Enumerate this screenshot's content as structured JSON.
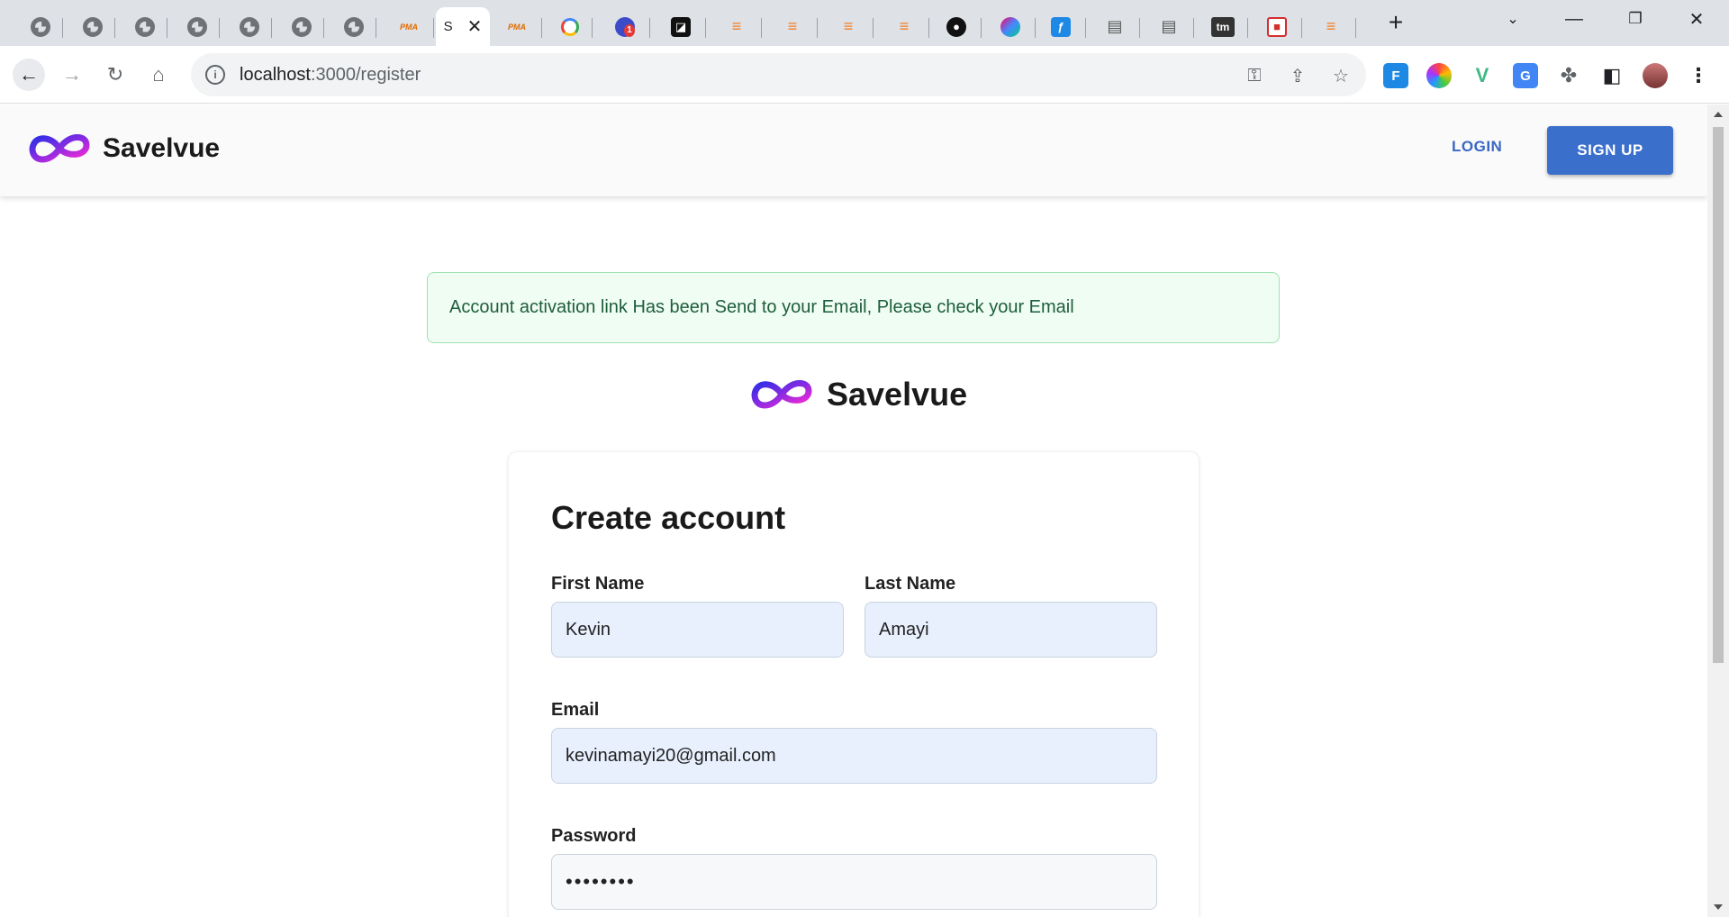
{
  "browser": {
    "active_tab_title": "S",
    "url_host": "localhost",
    "url_port_path": ":3000/register",
    "tab_pma_label": "PMA"
  },
  "navbar": {
    "brand": "Savelvue",
    "login": "LOGIN",
    "signup": "SIGN UP"
  },
  "alert": {
    "message": "Account activation link Has been Send to your Email, Please check your Email"
  },
  "logo": {
    "brand": "Savelvue"
  },
  "form": {
    "title": "Create account",
    "first_name_label": "First Name",
    "first_name_value": "Kevin",
    "last_name_label": "Last Name",
    "last_name_value": "Amayi",
    "email_label": "Email",
    "email_value": "kevinamayi20@gmail.com",
    "password_label": "Password",
    "password_value": "••••••••"
  },
  "colors": {
    "primary": "#3b6fcc",
    "alert_bg": "#effdf3",
    "alert_text": "#1e5e3a",
    "input_bg": "#e8f0fe"
  }
}
